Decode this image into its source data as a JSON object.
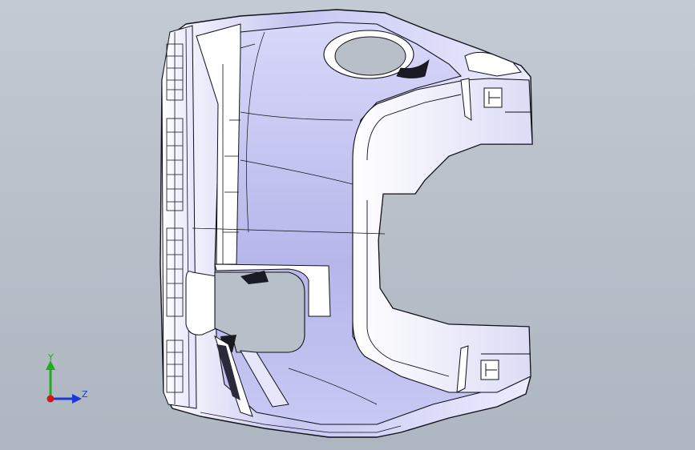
{
  "viewport": {
    "colors": {
      "background_top": "#c4cad3",
      "background_bottom": "#aeb6c1",
      "part_face_dark": "#b9b9ee",
      "part_face_light": "#ffffff",
      "part_edge": "#101018"
    }
  },
  "triad": {
    "y_label": "Y",
    "z_label": "Z",
    "y_color": "#22aa22",
    "z_color": "#1a3ad8",
    "x_color": "#d01818"
  }
}
